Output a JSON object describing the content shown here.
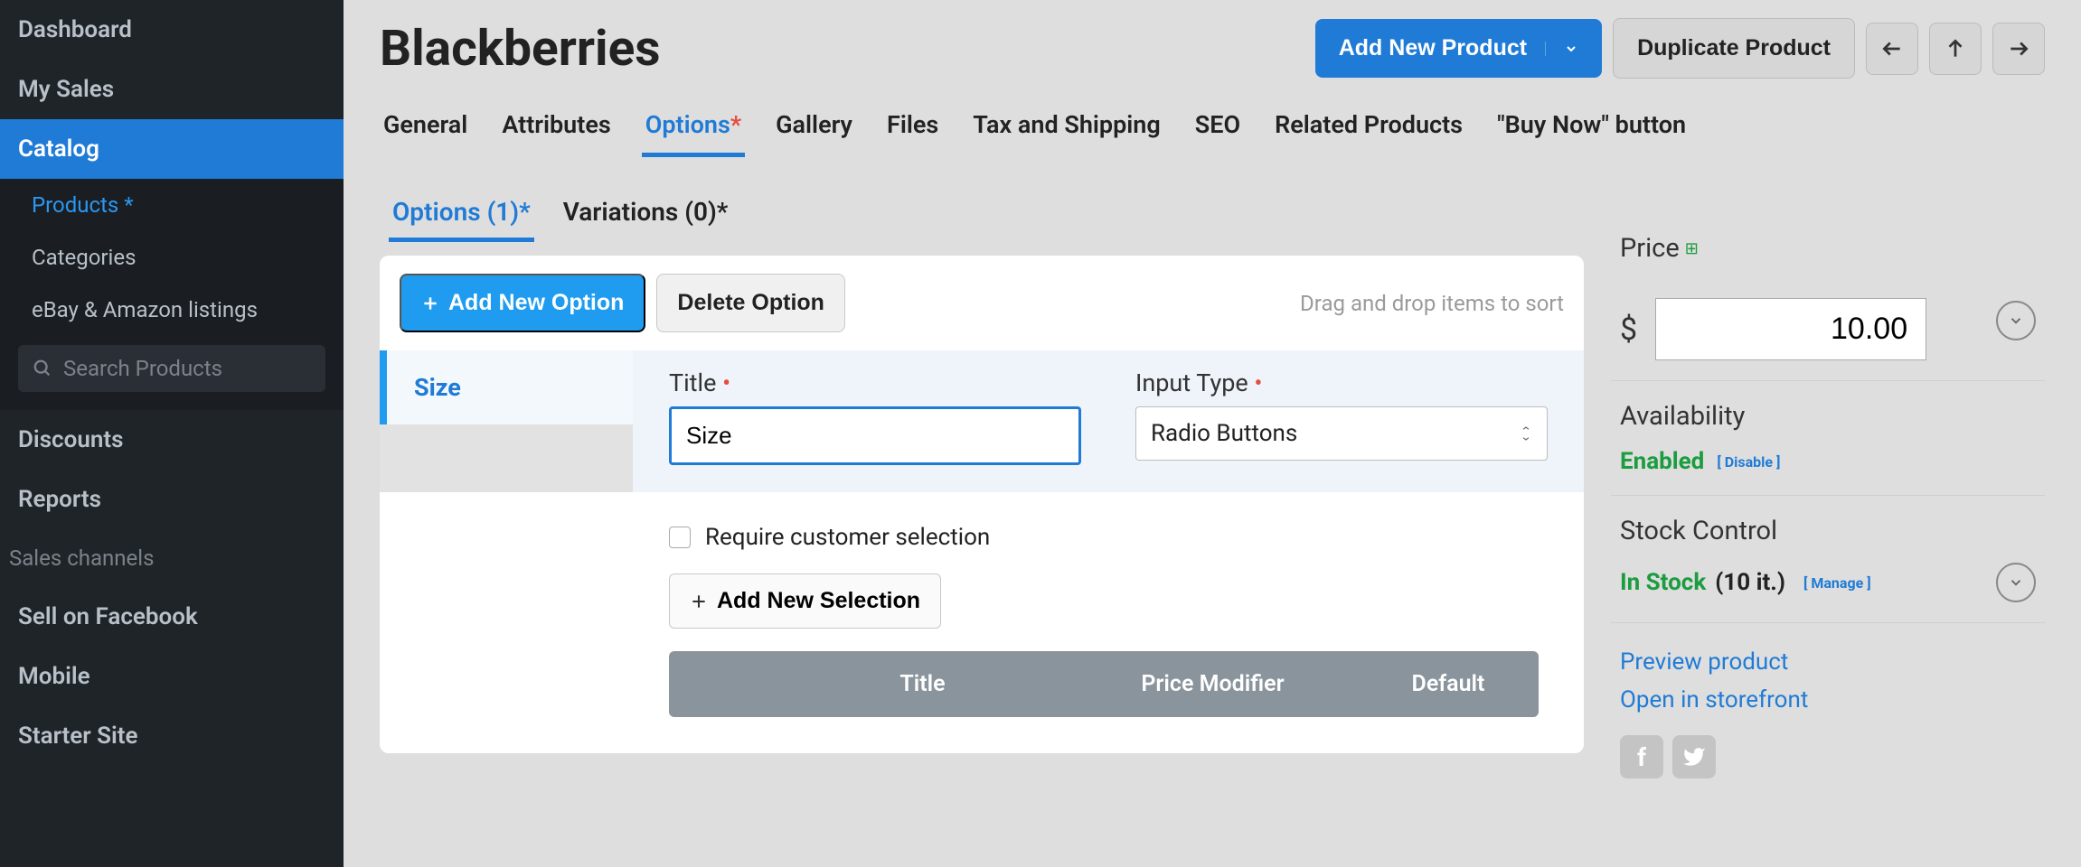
{
  "sidebar": {
    "items": [
      "Dashboard",
      "My Sales",
      "Catalog",
      "Discounts",
      "Reports"
    ],
    "catalog_sub": [
      "Products *",
      "Categories",
      "eBay & Amazon listings"
    ],
    "search_placeholder": "Search Products",
    "channels_label": "Sales channels",
    "channels": [
      "Sell on Facebook",
      "Mobile",
      "Starter Site"
    ]
  },
  "header": {
    "title": "Blackberries",
    "add_new": "Add New Product",
    "duplicate": "Duplicate Product"
  },
  "tabs": [
    "General",
    "Attributes",
    "Options*",
    "Gallery",
    "Files",
    "Tax and Shipping",
    "SEO",
    "Related Products",
    "\"Buy Now\" button"
  ],
  "subtabs": {
    "options": "Options (1)*",
    "variations": "Variations (0)*"
  },
  "toolbar": {
    "add_option": "Add New Option",
    "delete_option": "Delete Option",
    "hint": "Drag and drop items to sort"
  },
  "option": {
    "name": "Size",
    "title_label": "Title",
    "title_value": "Size",
    "input_type_label": "Input Type",
    "input_type_value": "Radio Buttons",
    "require_label": "Require customer selection",
    "add_selection": "Add New Selection",
    "table_headers": {
      "title": "Title",
      "price_modifier": "Price Modifier",
      "default": "Default"
    }
  },
  "aside": {
    "price_label": "Price",
    "currency": "$",
    "price_value": "10.00",
    "availability_label": "Availability",
    "availability_status": "Enabled",
    "availability_action": "[ Disable ]",
    "stock_label": "Stock Control",
    "stock_status": "In Stock",
    "stock_count": "(10 it.)",
    "stock_action": "[ Manage ]",
    "preview": "Preview product",
    "storefront": "Open in storefront"
  }
}
